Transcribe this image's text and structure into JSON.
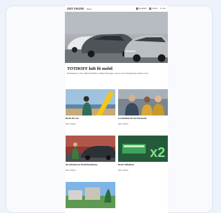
{
  "header": {
    "logo": "ZEIT ONLINE",
    "nav_label": "Menü",
    "account_label": "Anmelden",
    "search_label": "Suche",
    "subscribe_label": "Z+ Abo"
  },
  "lead": {
    "headline": "TOTHOFF hält fit mobil",
    "subline": "Elektroautos im Test: Welche Modelle im Alltag überzeugen und wo noch nachgebessert werden muss."
  },
  "tiles": [
    {
      "title": "Bereit für uns",
      "meta": "Mehr erfahren"
    },
    {
      "title": "Lernfreiheit für Sie Harmonie",
      "meta": "Mehr erfahren"
    },
    {
      "title": "Die ultimativen Sicherheitslösung",
      "meta": "Mehr erfahren"
    },
    {
      "title": "Bereit Teilnahme",
      "meta": "Mehr erfahren"
    },
    {
      "title": "",
      "meta": ""
    }
  ],
  "colors": {
    "background": "#eef2fa",
    "card": "#f9fafd",
    "accent_yellow": "#f5c518",
    "accent_green": "#1f8a3a"
  }
}
